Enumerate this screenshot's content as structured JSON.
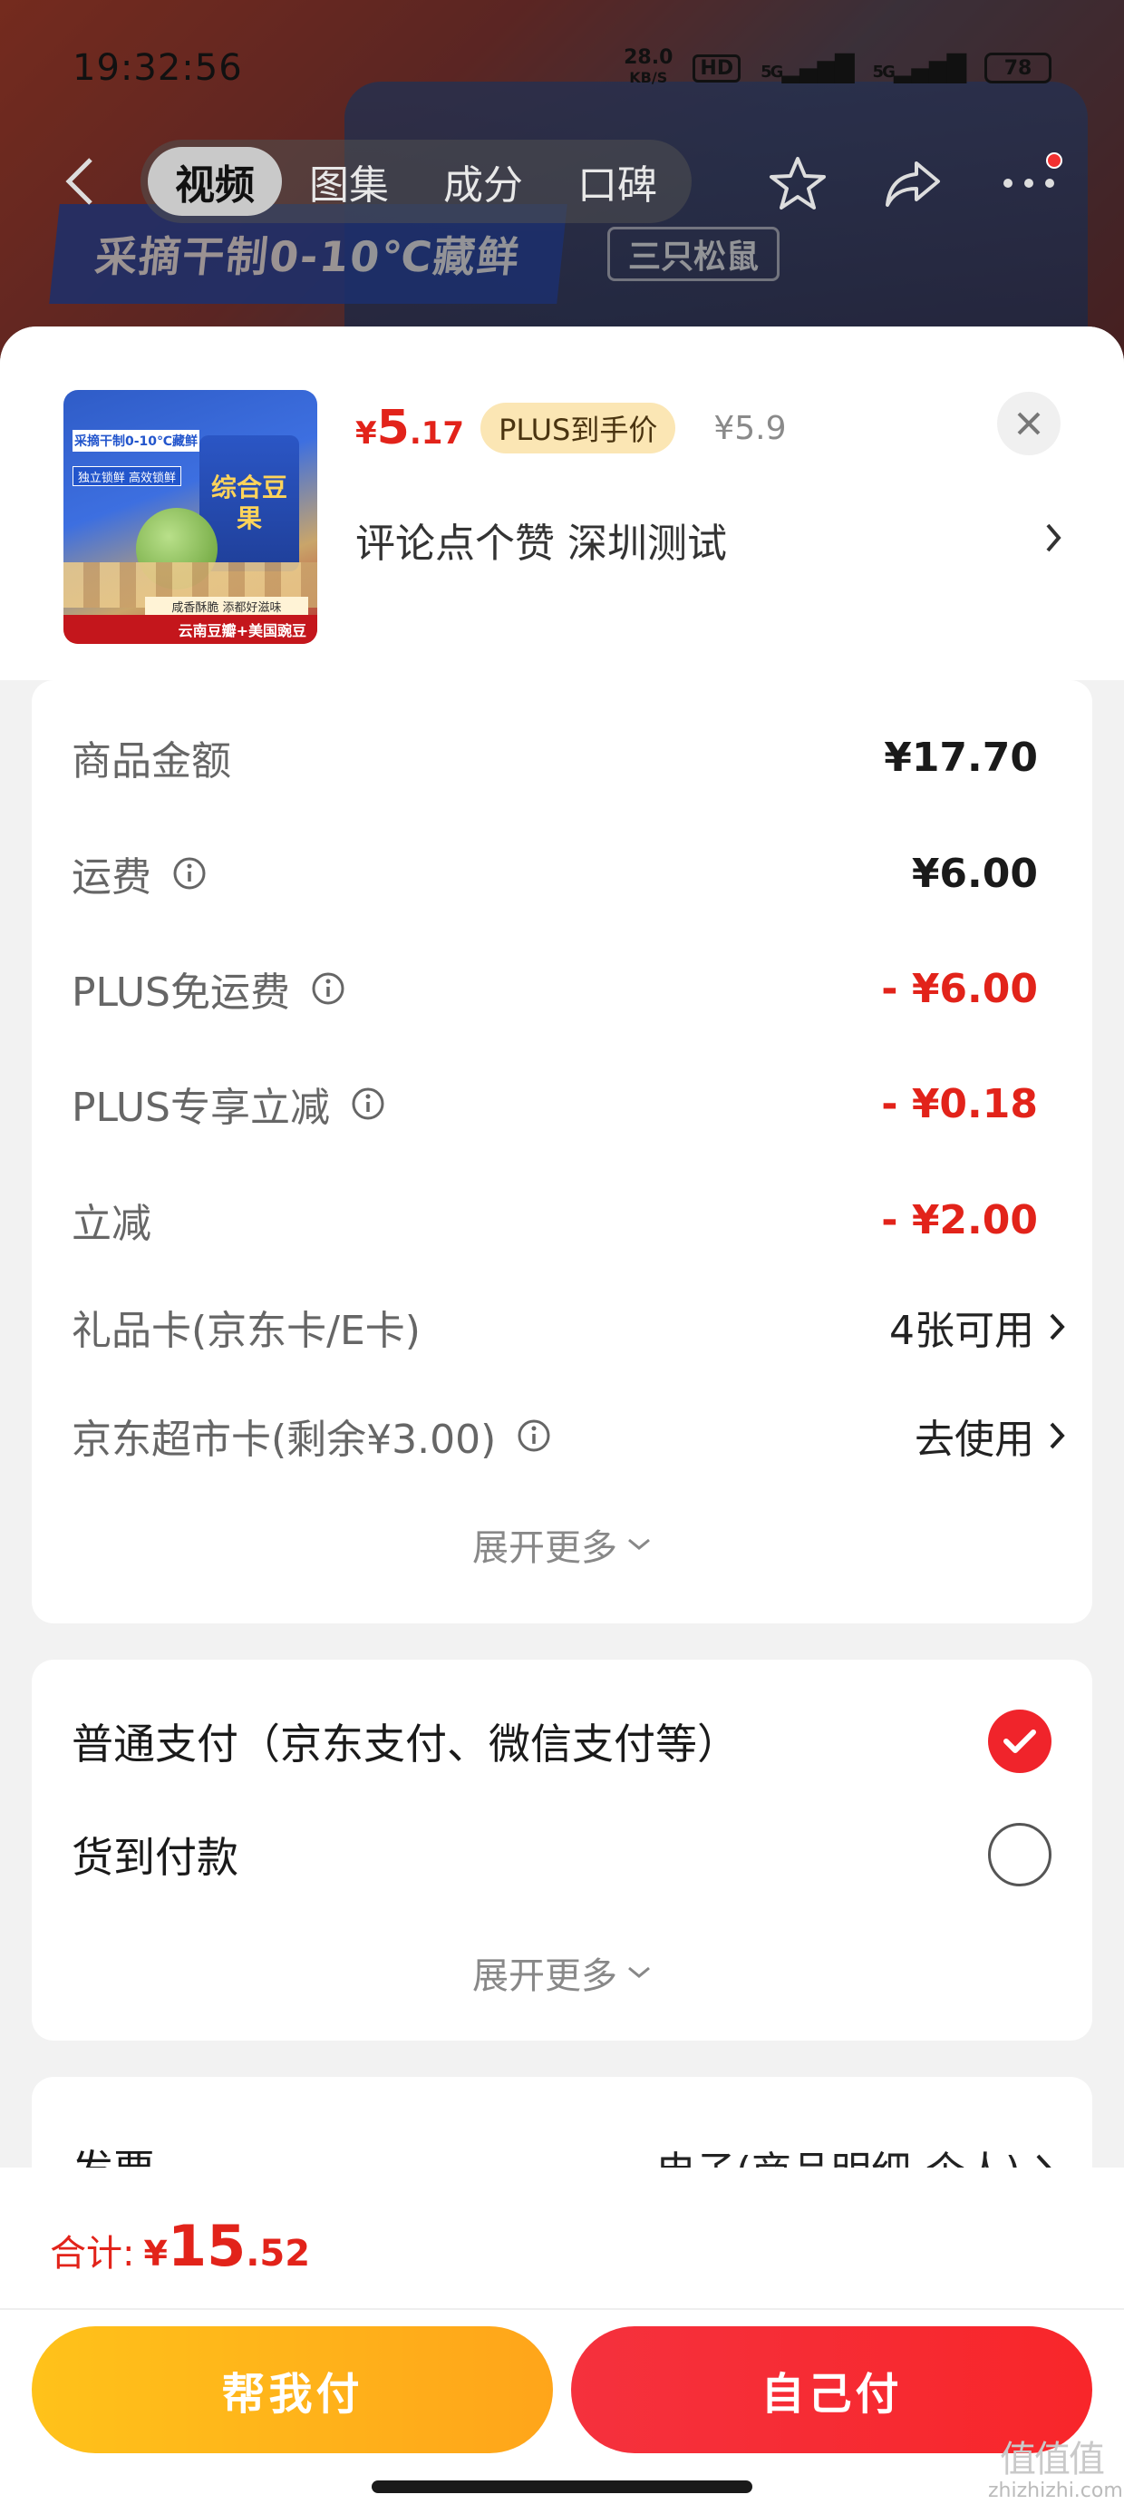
{
  "status_bar": {
    "time": "19:32:56",
    "net_speed_value": "28.0",
    "net_speed_unit": "KB/S",
    "hd_label": "HD",
    "signal1": "5G",
    "signal2": "5G",
    "battery": "78"
  },
  "top_nav": {
    "tabs": [
      {
        "label": "视频",
        "active": true
      },
      {
        "label": "图集",
        "active": false
      },
      {
        "label": "成分",
        "active": false
      },
      {
        "label": "口碑",
        "active": false
      }
    ]
  },
  "background_banner": {
    "slogan": "采摘干制0-10℃藏鲜",
    "brand": "三只松鼠"
  },
  "product": {
    "price_symbol": "¥",
    "price_int": "5",
    "price_dec": ".17",
    "plus_badge": "PLUS到手价",
    "original_price": "¥5.9",
    "spec": "评论点个赞  深圳测试",
    "thumb": {
      "top_text": "采摘干制0-10℃藏鲜",
      "tag": "独立锁鲜 高效锁鲜",
      "pack_text": "综合豆果",
      "slogan": "咸香酥脆 添都好滋味",
      "footer": "云南豆瓣+美国豌豆"
    }
  },
  "fees": [
    {
      "label": "商品金额",
      "value": "¥17.70",
      "info": false,
      "style": "bold"
    },
    {
      "label": "运费",
      "value": "¥6.00",
      "info": true,
      "style": "bold"
    },
    {
      "label": "PLUS免运费",
      "value": "- ¥6.00",
      "info": true,
      "style": "red"
    },
    {
      "label": "PLUS专享立减",
      "value": "- ¥0.18",
      "info": true,
      "style": "red"
    },
    {
      "label": "立减",
      "value": "- ¥2.00",
      "info": false,
      "style": "red"
    },
    {
      "label": "礼品卡(京东卡/E卡)",
      "value": "4张可用",
      "info": false,
      "style": "arrow"
    },
    {
      "label": "京东超市卡(剩余¥3.00)",
      "value": "去使用",
      "info": true,
      "style": "arrow"
    }
  ],
  "fees_expand": "展开更多",
  "payment": {
    "options": [
      {
        "label": "普通支付（京东支付、微信支付等）",
        "checked": true
      },
      {
        "label": "货到付款",
        "checked": false
      }
    ],
    "expand": "展开更多"
  },
  "invoice": {
    "label": "发票",
    "value": "电子(商品明细-个人)"
  },
  "bottom": {
    "total_label": "合计:",
    "total_symbol": "¥",
    "total_int": "15",
    "total_dec": ".52",
    "help_pay": "帮我付",
    "self_pay": "自己付"
  },
  "watermark": {
    "big": "值值值",
    "small": "zhizhizhi.com"
  },
  "colors": {
    "price_red": "#e2231a",
    "help_btn": "#ffb21a",
    "self_btn": "#f52c34",
    "plus_badge_bg": "#fbe6b4"
  }
}
